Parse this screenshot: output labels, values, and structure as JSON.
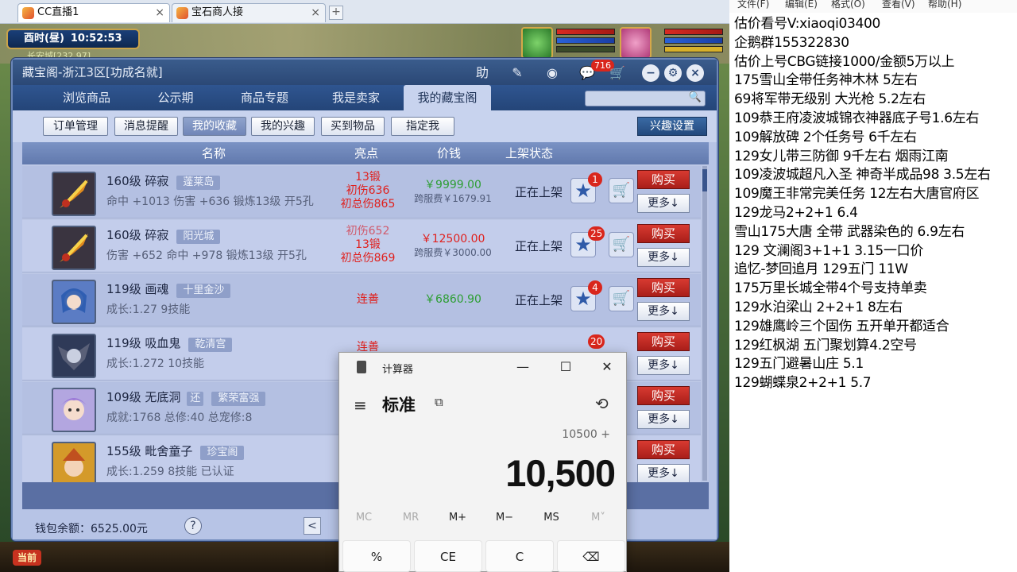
{
  "browser": {
    "tabs": [
      {
        "label": "CC直播1"
      },
      {
        "label": "宝石商人接"
      }
    ]
  },
  "game": {
    "time_label": "酉时(昼)",
    "clock": "10:52:53",
    "location": "长安城[232,97]"
  },
  "panel": {
    "title": "藏宝阁-浙江3区[功成名就]",
    "help_label": "助",
    "badge": "716",
    "nav_tabs": [
      "浏览商品",
      "公示期",
      "商品专题",
      "我是卖家",
      "我的藏宝阁"
    ],
    "sub_tabs": [
      "订单管理",
      "消息提醒",
      "我的收藏",
      "我的兴趣",
      "买到物品",
      "指定我"
    ],
    "interest_btn": "兴趣设置",
    "columns": {
      "name": "名称",
      "highlight": "亮点",
      "price": "价钱",
      "status": "上架状态"
    },
    "buy_label": "购买",
    "more_label": "更多↓",
    "rows": [
      {
        "name": "160级 碎寂",
        "server": "蓬莱岛",
        "attr": "命中 +1013 伤害 +636 锻炼13级 开5孔",
        "hl": [
          "13锻",
          "初伤636",
          "初总伤865"
        ],
        "price": "￥9999.00",
        "fee": "跨服费￥1679.91",
        "status": "正在上架",
        "stars": "1"
      },
      {
        "name": "160级 碎寂",
        "server": "阳光城",
        "attr": "伤害 +652 命中 +978 锻炼13级 开5孔",
        "hl": [
          "初伤652",
          "13锻",
          "初总伤869"
        ],
        "price": "￥12500.00",
        "fee": "跨服费￥3000.00",
        "status": "正在上架",
        "stars": "25"
      },
      {
        "name": "119级 画魂",
        "server": "十里金沙",
        "attr": "成长:1.27 9技能",
        "hl": [
          "连善"
        ],
        "price": "￥6860.90",
        "fee": "",
        "status": "正在上架",
        "stars": "4"
      },
      {
        "name": "119级 吸血鬼",
        "server": "乾清宫",
        "attr": "成长:1.272 10技能",
        "hl": [
          "连善"
        ],
        "price": "",
        "fee": "",
        "status": "",
        "stars": "20"
      },
      {
        "name": "109级 无底洞",
        "server": "繁荣富强",
        "tag": "还",
        "attr": "成就:1768 总修:40 总宠修:8",
        "hl": [],
        "price": "",
        "fee": "",
        "status": "",
        "stars": ""
      },
      {
        "name": "155级 毗舍童子",
        "server": "珍宝阁",
        "attr": "成长:1.259 8技能 已认证",
        "hl": [],
        "price": "",
        "fee": "",
        "status": "",
        "stars": ""
      }
    ],
    "wallet": "钱包余额：6525.00元",
    "help_q": "?",
    "pager_prev": "<"
  },
  "bottom": {
    "dangqian": "当前"
  },
  "calculator": {
    "app_title": "计算器",
    "mode": "标准",
    "expression": "10500 +",
    "display": "10,500",
    "memory": [
      "MC",
      "MR",
      "M+",
      "M−",
      "MS",
      "M˅"
    ],
    "keys": [
      "%",
      "CE",
      "C",
      "⌫"
    ]
  },
  "notepad": {
    "menu": [
      "文件(F)",
      "编辑(E)",
      "格式(O)",
      "查看(V)",
      "帮助(H)"
    ],
    "lines": [
      "估价看号V:xiaoqi03400",
      "企鹅群155322830",
      "估价上号CBG链接1000/金额5万以上",
      "175雪山全带任务神木林 5左右",
      "69将军带无级别 大光枪 5.2左右",
      "109恭王府凌波城锦衣神器底子号1.6左右",
      "109解放碑 2个任务号 6千左右",
      "129女儿带三防御 9千左右 烟雨江南",
      "109凌波城超凡入圣 神奇半成品98 3.5左右",
      "109魔王非常完美任务 12左右大唐官府区",
      "129龙马2+2+1  6.4",
      "雪山175大唐 全带 武器染色的 6.9左右",
      "129 文澜阁3+1+1   3.15一口价",
      "追忆-梦回追月 129五门 11W",
      "175万里长城全带4个号支持单卖",
      "129水泊梁山 2+2+1 8左右",
      "129雄鹰岭三个固伤 五开单开都适合",
      "129红枫湖 五门聚划算4.2空号",
      "129五门避暑山庄  5.1",
      "129蝴蝶泉2+2+1  5.7"
    ]
  }
}
